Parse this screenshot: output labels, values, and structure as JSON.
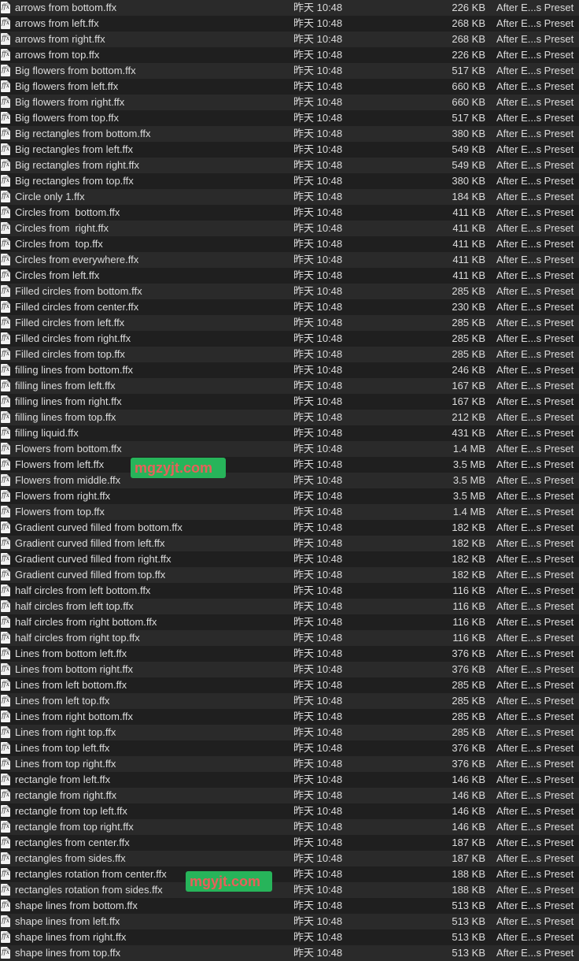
{
  "icon_name": "ffx-file-icon",
  "icon_glyph": "ffx",
  "date_text": "昨天 10:48",
  "kind_text": "After E...s Preset",
  "watermarks": [
    "mgzyjt.com",
    "mgyjt.com"
  ],
  "files": [
    {
      "name": "arrows from bottom.ffx",
      "size": "226 KB"
    },
    {
      "name": "arrows from left.ffx",
      "size": "268 KB"
    },
    {
      "name": "arrows from right.ffx",
      "size": "268 KB"
    },
    {
      "name": "arrows from top.ffx",
      "size": "226 KB"
    },
    {
      "name": "Big flowers from bottom.ffx",
      "size": "517 KB"
    },
    {
      "name": "Big flowers from left.ffx",
      "size": "660 KB"
    },
    {
      "name": "Big flowers from right.ffx",
      "size": "660 KB"
    },
    {
      "name": "Big flowers from top.ffx",
      "size": "517 KB"
    },
    {
      "name": "Big rectangles from bottom.ffx",
      "size": "380 KB"
    },
    {
      "name": "Big rectangles from left.ffx",
      "size": "549 KB"
    },
    {
      "name": "Big rectangles from right.ffx",
      "size": "549 KB"
    },
    {
      "name": "Big rectangles from top.ffx",
      "size": "380 KB"
    },
    {
      "name": "Circle only 1.ffx",
      "size": "184 KB"
    },
    {
      "name": "Circles from  bottom.ffx",
      "size": "411 KB"
    },
    {
      "name": "Circles from  right.ffx",
      "size": "411 KB"
    },
    {
      "name": "Circles from  top.ffx",
      "size": "411 KB"
    },
    {
      "name": "Circles from everywhere.ffx",
      "size": "411 KB"
    },
    {
      "name": "Circles from left.ffx",
      "size": "411 KB"
    },
    {
      "name": "Filled circles from bottom.ffx",
      "size": "285 KB"
    },
    {
      "name": "Filled circles from center.ffx",
      "size": "230 KB"
    },
    {
      "name": "Filled circles from left.ffx",
      "size": "285 KB"
    },
    {
      "name": "Filled circles from right.ffx",
      "size": "285 KB"
    },
    {
      "name": "Filled circles from top.ffx",
      "size": "285 KB"
    },
    {
      "name": "filling lines from bottom.ffx",
      "size": "246 KB"
    },
    {
      "name": "filling lines from left.ffx",
      "size": "167 KB"
    },
    {
      "name": "filling lines from right.ffx",
      "size": "167 KB"
    },
    {
      "name": "filling lines from top.ffx",
      "size": "212 KB"
    },
    {
      "name": "filling liquid.ffx",
      "size": "431 KB"
    },
    {
      "name": "Flowers from bottom.ffx",
      "size": "1.4 MB"
    },
    {
      "name": "Flowers from left.ffx",
      "size": "3.5 MB"
    },
    {
      "name": "Flowers from middle.ffx",
      "size": "3.5 MB"
    },
    {
      "name": "Flowers from right.ffx",
      "size": "3.5 MB"
    },
    {
      "name": "Flowers from top.ffx",
      "size": "1.4 MB"
    },
    {
      "name": "Gradient curved filled from bottom.ffx",
      "size": "182 KB"
    },
    {
      "name": "Gradient curved filled from left.ffx",
      "size": "182 KB"
    },
    {
      "name": "Gradient curved filled from right.ffx",
      "size": "182 KB"
    },
    {
      "name": "Gradient curved filled from top.ffx",
      "size": "182 KB"
    },
    {
      "name": "half circles from left bottom.ffx",
      "size": "116 KB"
    },
    {
      "name": "half circles from left top.ffx",
      "size": "116 KB"
    },
    {
      "name": "half circles from right bottom.ffx",
      "size": "116 KB"
    },
    {
      "name": "half circles from right top.ffx",
      "size": "116 KB"
    },
    {
      "name": "Lines from bottom left.ffx",
      "size": "376 KB"
    },
    {
      "name": "Lines from bottom right.ffx",
      "size": "376 KB"
    },
    {
      "name": "Lines from left bottom.ffx",
      "size": "285 KB"
    },
    {
      "name": "Lines from left top.ffx",
      "size": "285 KB"
    },
    {
      "name": "Lines from right bottom.ffx",
      "size": "285 KB"
    },
    {
      "name": "Lines from right top.ffx",
      "size": "285 KB"
    },
    {
      "name": "Lines from top left.ffx",
      "size": "376 KB"
    },
    {
      "name": "Lines from top right.ffx",
      "size": "376 KB"
    },
    {
      "name": "rectangle from left.ffx",
      "size": "146 KB"
    },
    {
      "name": "rectangle from right.ffx",
      "size": "146 KB"
    },
    {
      "name": "rectangle from top left.ffx",
      "size": "146 KB"
    },
    {
      "name": "rectangle from top right.ffx",
      "size": "146 KB"
    },
    {
      "name": "rectangles from center.ffx",
      "size": "187 KB"
    },
    {
      "name": "rectangles from sides.ffx",
      "size": "187 KB"
    },
    {
      "name": "rectangles rotation from center.ffx",
      "size": "188 KB"
    },
    {
      "name": "rectangles rotation from sides.ffx",
      "size": "188 KB"
    },
    {
      "name": "shape lines from bottom.ffx",
      "size": "513 KB"
    },
    {
      "name": "shape lines from left.ffx",
      "size": "513 KB"
    },
    {
      "name": "shape lines from right.ffx",
      "size": "513 KB"
    },
    {
      "name": "shape lines from top.ffx",
      "size": "513 KB"
    }
  ]
}
